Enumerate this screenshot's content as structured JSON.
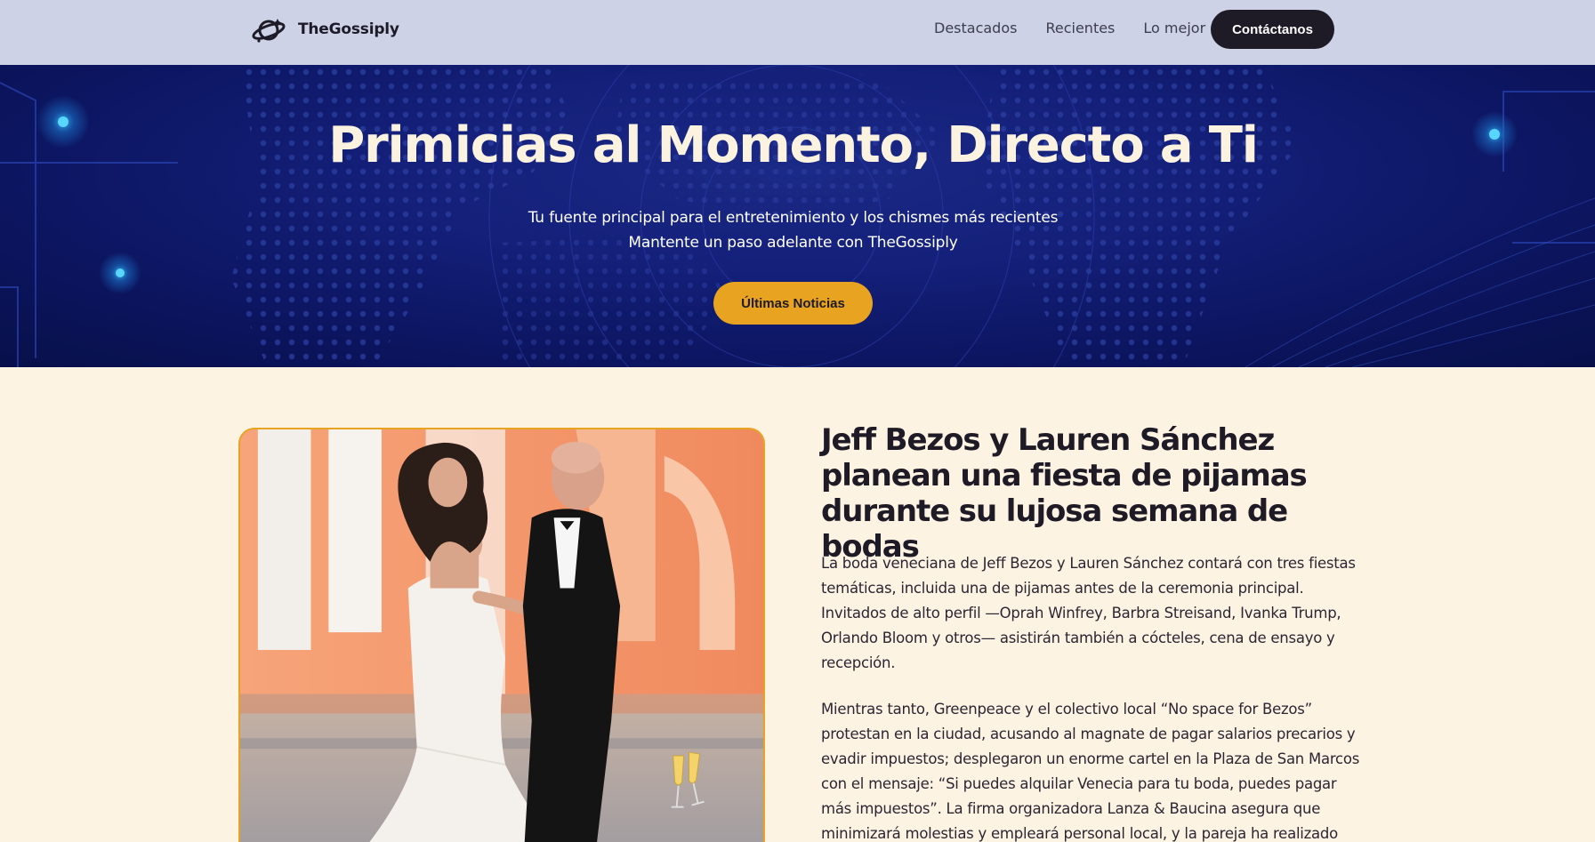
{
  "brand": {
    "name": "TheGossiply",
    "logo_icon": "planet-logo-icon"
  },
  "nav": {
    "links": [
      "Destacados",
      "Recientes",
      "Lo mejor"
    ],
    "cta_label": "Contáctanos"
  },
  "hero": {
    "title": "Primicias al Momento, Directo a Ti",
    "subtitle_line1": "Tu fuente principal para el entretenimiento y los chismes más recientes",
    "subtitle_line2": "Mantente un paso adelante con TheGossiply",
    "button_label": "Últimas Noticias"
  },
  "article": {
    "title": "Jeff Bezos y Lauren Sánchez planean una fiesta de pijamas durante su lujosa semana de bodas",
    "paragraph1": "La boda veneciana de Jeff Bezos y Lauren Sánchez contará con tres fiestas temáticas, incluida una de pijamas antes de la ceremonia principal. Invitados de alto perfil —Oprah Winfrey, Barbra Streisand, Ivanka Trump, Orlando Bloom y otros— asistirán también a cócteles, cena de ensayo y recepción.",
    "paragraph2": "Mientras tanto, Greenpeace y el colectivo local “No space for Bezos” protestan en la ciudad, acusando al magnate de pagar salarios precarios y evadir impuestos; desplegaron un enorme cartel en la Plaza de San Marcos con el mensaje: “Si puedes alquilar Venecia para tu boda, puedes pagar más impuestos”. La firma organizadora Lanza & Baucina asegura que minimizará molestias y empleará personal local, y la pareja ha realizado",
    "image_icon": "champagne-glasses-icon"
  },
  "colors": {
    "nav_bg": "#cdd2e6",
    "hero_bg": "#14207a",
    "accent": "#e8a321",
    "page_bg": "#fdf3e3",
    "dark": "#1e1a26"
  }
}
